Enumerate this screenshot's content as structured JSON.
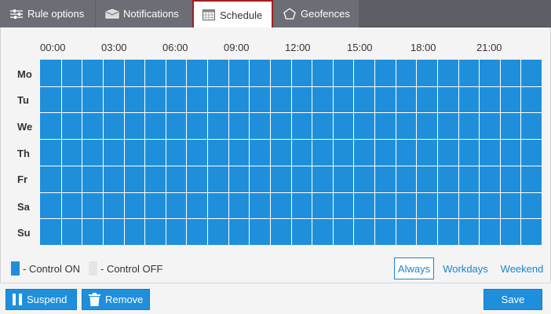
{
  "tabs": {
    "rule_options": "Rule options",
    "notifications": "Notifications",
    "schedule": "Schedule",
    "geofences": "Geofences"
  },
  "schedule": {
    "hours": [
      "00:00",
      "03:00",
      "06:00",
      "09:00",
      "12:00",
      "15:00",
      "18:00",
      "21:00"
    ],
    "days": [
      "Mo",
      "Tu",
      "We",
      "Th",
      "Fr",
      "Sa",
      "Su"
    ],
    "cells_per_day": 24,
    "all_cells_on": true
  },
  "legend": {
    "on_label": "- Control ON",
    "off_label": "- Control OFF"
  },
  "presets": {
    "always": "Always",
    "workdays": "Workdays",
    "weekend": "Weekend",
    "selected": "Always"
  },
  "footer": {
    "suspend": "Suspend",
    "remove": "Remove",
    "save": "Save"
  },
  "colors": {
    "on": "#1f8fdc",
    "off": "#e6e6e6",
    "active_tab_border": "#a71d1d",
    "tabbar": "#5c5f66"
  }
}
